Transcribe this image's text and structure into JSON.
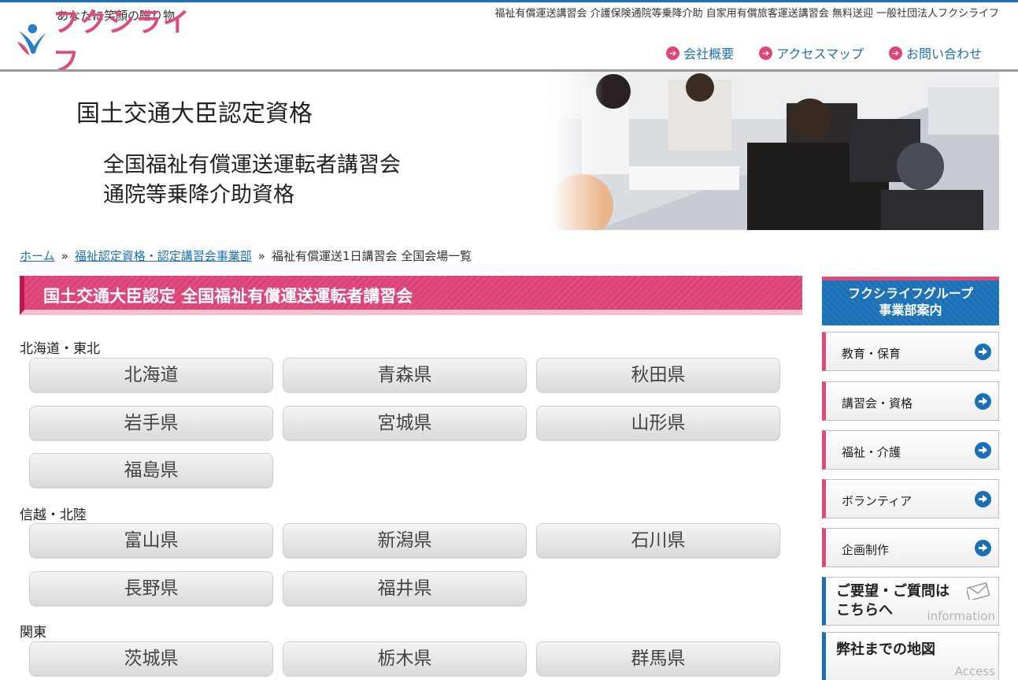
{
  "header": {
    "tagline": "あなたに笑顔の贈り物",
    "logo_text": "フクシライフ",
    "top_links": "福祉有償運送講習会 介護保険通院等乗降介助 自家用有償旅客運送講習会 無料送迎 一般社団法人フクシライフ",
    "nav": [
      {
        "label": "会社概要",
        "icon": "arrow-circle-icon"
      },
      {
        "label": "アクセスマップ",
        "icon": "arrow-circle-icon"
      },
      {
        "label": "お問い合わせ",
        "icon": "arrow-circle-icon"
      }
    ]
  },
  "banner": {
    "title": "国土交通大臣認定資格",
    "line1": "全国福祉有償運送運転者講習会",
    "line2": "通院等乗降介助資格"
  },
  "breadcrumb": {
    "home": "ホーム",
    "sep": "»",
    "section": "福祉認定資格・認定講習会事業部",
    "current": "福祉有償運送1日講習会 全国会場一覧"
  },
  "main": {
    "heading": "国土交通大臣認定 全国福祉有償運送運転者講習会",
    "regions": [
      {
        "label": "北海道・東北",
        "prefectures": [
          "北海道",
          "青森県",
          "秋田県",
          "岩手県",
          "宮城県",
          "山形県",
          "福島県"
        ]
      },
      {
        "label": "信越・北陸",
        "prefectures": [
          "富山県",
          "新潟県",
          "石川県",
          "長野県",
          "福井県"
        ]
      },
      {
        "label": "関東",
        "prefectures": [
          "茨城県",
          "栃木県",
          "群馬県"
        ]
      }
    ]
  },
  "sidebar": {
    "heading_line1": "フクシライフグループ",
    "heading_line2": "事業部案内",
    "items": [
      "教育・保育",
      "講習会・資格",
      "福祉・介護",
      "ボランティア",
      "企画制作"
    ],
    "contact_line1": "ご要望・ご質問は",
    "contact_line2": "こちらへ",
    "contact_en": "information",
    "map_label": "弊社までの地図",
    "map_en": "Access"
  },
  "colors": {
    "accent_pink": "#e04a7a",
    "accent_blue": "#1a70b8"
  }
}
